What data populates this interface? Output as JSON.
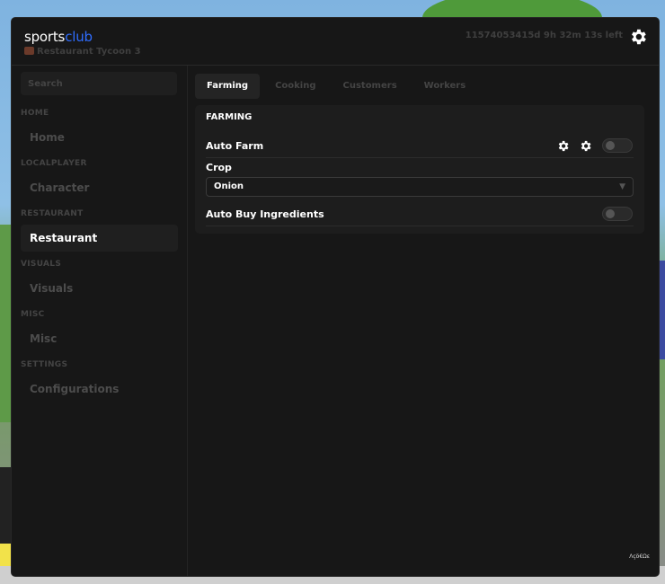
{
  "app": {
    "brand_plain": "sports",
    "brand_accent": "club",
    "subtitle": "Restaurant Tycoon 3",
    "timer": "11574053415d 9h 32m 13s left",
    "accent_color": "#2f6dff"
  },
  "sidebar": {
    "search_placeholder": "Search",
    "sections": [
      {
        "label": "HOME",
        "item": "Home"
      },
      {
        "label": "LOCALPLAYER",
        "item": "Character"
      },
      {
        "label": "RESTAURANT",
        "item": "Restaurant"
      },
      {
        "label": "VISUALS",
        "item": "Visuals"
      },
      {
        "label": "MISC",
        "item": "Misc"
      },
      {
        "label": "SETTINGS",
        "item": "Configurations"
      }
    ],
    "active": "Restaurant"
  },
  "tabs": [
    {
      "label": "Farming",
      "active": true
    },
    {
      "label": "Cooking",
      "active": false
    },
    {
      "label": "Customers",
      "active": false
    },
    {
      "label": "Workers",
      "active": false
    }
  ],
  "panel": {
    "title": "FARMING",
    "auto_farm_label": "Auto Farm",
    "auto_farm_on": false,
    "crop_label": "Crop",
    "crop_value": "Onion",
    "auto_buy_label": "Auto Buy Ingredients",
    "auto_buy_on": false
  },
  "footer_mark": "Λçö€Ωε"
}
